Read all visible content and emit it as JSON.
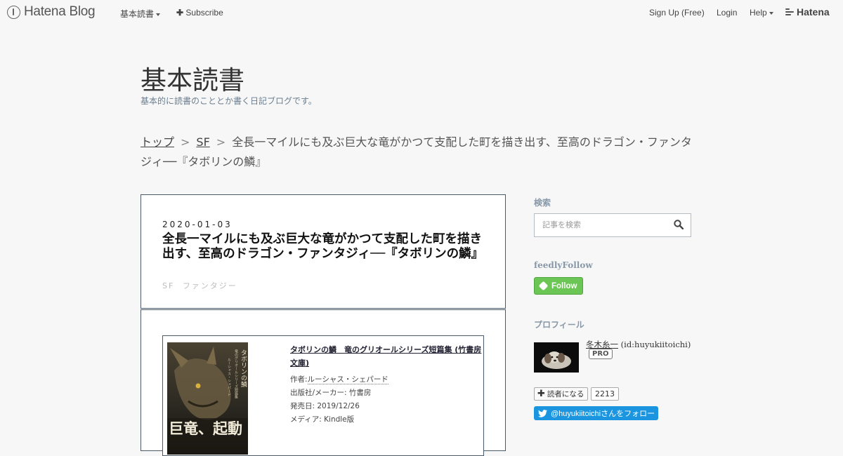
{
  "global_header": {
    "logo_text": "Hatena Blog",
    "nav_blog_menu": "基本読書",
    "nav_subscribe": "Subscribe",
    "signup": "Sign Up (Free)",
    "login": "Login",
    "help": "Help",
    "hatena": "Hatena"
  },
  "blog": {
    "title": "基本読書",
    "description": "基本的に読書のこととか書く日記ブログです。"
  },
  "breadcrumb": {
    "items": [
      "トップ",
      "SF"
    ],
    "separator": ">",
    "current": "全長一マイルにも及ぶ巨大な竜がかつて支配した町を描き出す、至高のドラゴン・ファンタジィ──『タボリンの鱗』"
  },
  "article": {
    "date": "2020-01-03",
    "title": "全長一マイルにも及ぶ巨大な竜がかつて支配した町を描き出す、至高のドラゴン・ファンタジィ──『タボリンの鱗』",
    "categories": [
      "SF",
      "ファンタジー"
    ],
    "product": {
      "cover_texts": {
        "title": "タボリンの鱗",
        "series": "竜のグリオールシリーズ短篇集",
        "author": "ルーシャス・シェパード",
        "band": "巨竜、起動"
      },
      "title": "タボリンの鱗　竜のグリオールシリーズ短篇集 (竹書房文庫)",
      "author_label": "作者:",
      "author": "ルーシャス・シェパード",
      "publisher": "出版社/メーカー: 竹書房",
      "release": "発売日: 2019/12/26",
      "media": "メディア: Kindle版"
    }
  },
  "sidebar": {
    "search_heading": "検索",
    "search_placeholder": "記事を検索",
    "feedly_heading": "feedlyFollow",
    "feedly_button": "Follow",
    "profile_heading": "プロフィール",
    "profile_name": "冬木糸一",
    "profile_id": "(id:huyukiitoichi)",
    "pro_badge": "PRO",
    "subscribe_label": "読者になる",
    "subscribe_count": "2213",
    "twitter_follow": "@huyukiitoichiさんをフォロー"
  },
  "colors": {
    "background": "#f7f7f7",
    "border": "#4a5a6a",
    "feedly_green": "#6cc655",
    "twitter_blue": "#1b95e0",
    "sidebar_heading": "#8898a8"
  }
}
